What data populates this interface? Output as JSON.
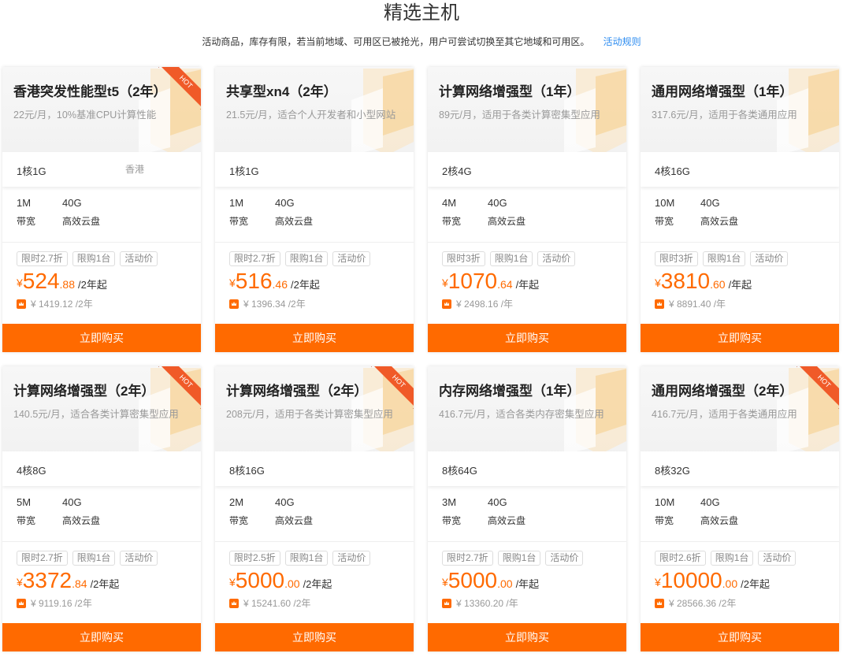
{
  "header": {
    "title": "精选主机",
    "notice": "活动商品，库存有限，若当前地域、可用区已被抢光，用户可尝试切换至其它地域和可用区。",
    "rules_link": "活动规则"
  },
  "cards": [
    {
      "title": "香港突发性能型t5（2年）",
      "desc": "22元/月，10%基准CPU计算性能",
      "hot": true,
      "hot_label": "HOT",
      "spec": "1核1G",
      "region": "香港",
      "bandwidth": "1M",
      "bandwidth_label": "带宽",
      "disk": "40G",
      "disk_label": "高效云盘",
      "tags": [
        "限时2.7折",
        "限购1台",
        "活动价"
      ],
      "currency": "¥",
      "price_int": "524",
      "price_dec": ".88",
      "price_unit": "/2年起",
      "orig_price": "¥ 1419.12 /2年",
      "buy_label": "立即购买"
    },
    {
      "title": "共享型xn4（2年）",
      "desc": "21.5元/月，适合个人开发者和小型网站",
      "hot": false,
      "hot_label": "",
      "spec": "1核1G",
      "region": "",
      "bandwidth": "1M",
      "bandwidth_label": "带宽",
      "disk": "40G",
      "disk_label": "高效云盘",
      "tags": [
        "限时2.7折",
        "限购1台",
        "活动价"
      ],
      "currency": "¥",
      "price_int": "516",
      "price_dec": ".46",
      "price_unit": "/2年起",
      "orig_price": "¥ 1396.34 /2年",
      "buy_label": "立即购买"
    },
    {
      "title": "计算网络增强型（1年）",
      "desc": "89元/月，适用于各类计算密集型应用",
      "hot": false,
      "hot_label": "",
      "spec": "2核4G",
      "region": "",
      "bandwidth": "4M",
      "bandwidth_label": "带宽",
      "disk": "40G",
      "disk_label": "高效云盘",
      "tags": [
        "限时3折",
        "限购1台",
        "活动价"
      ],
      "currency": "¥",
      "price_int": "1070",
      "price_dec": ".64",
      "price_unit": "/年起",
      "orig_price": "¥ 2498.16 /年",
      "buy_label": "立即购买"
    },
    {
      "title": "通用网络增强型（1年）",
      "desc": "317.6元/月，适用于各类通用应用",
      "hot": false,
      "hot_label": "",
      "spec": "4核16G",
      "region": "",
      "bandwidth": "10M",
      "bandwidth_label": "带宽",
      "disk": "40G",
      "disk_label": "高效云盘",
      "tags": [
        "限时3折",
        "限购1台",
        "活动价"
      ],
      "currency": "¥",
      "price_int": "3810",
      "price_dec": ".60",
      "price_unit": "/年起",
      "orig_price": "¥ 8891.40 /年",
      "buy_label": "立即购买"
    },
    {
      "title": "计算网络增强型（2年）",
      "desc": "140.5元/月，适合各类计算密集型应用",
      "hot": true,
      "hot_label": "HOT",
      "spec": "4核8G",
      "region": "",
      "bandwidth": "5M",
      "bandwidth_label": "带宽",
      "disk": "40G",
      "disk_label": "高效云盘",
      "tags": [
        "限时2.7折",
        "限购1台",
        "活动价"
      ],
      "currency": "¥",
      "price_int": "3372",
      "price_dec": ".84",
      "price_unit": "/2年起",
      "orig_price": "¥ 9119.16 /2年",
      "buy_label": "立即购买"
    },
    {
      "title": "计算网络增强型（2年）",
      "desc": "208元/月，适用于各类计算密集型应用",
      "hot": true,
      "hot_label": "HOT",
      "spec": "8核16G",
      "region": "",
      "bandwidth": "2M",
      "bandwidth_label": "带宽",
      "disk": "40G",
      "disk_label": "高效云盘",
      "tags": [
        "限时2.5折",
        "限购1台",
        "活动价"
      ],
      "currency": "¥",
      "price_int": "5000",
      "price_dec": ".00",
      "price_unit": "/2年起",
      "orig_price": "¥ 15241.60 /2年",
      "buy_label": "立即购买"
    },
    {
      "title": "内存网络增强型（1年）",
      "desc": "416.7元/月，适合各类内存密集型应用",
      "hot": false,
      "hot_label": "",
      "spec": "8核64G",
      "region": "",
      "bandwidth": "3M",
      "bandwidth_label": "带宽",
      "disk": "40G",
      "disk_label": "高效云盘",
      "tags": [
        "限时2.7折",
        "限购1台",
        "活动价"
      ],
      "currency": "¥",
      "price_int": "5000",
      "price_dec": ".00",
      "price_unit": "/年起",
      "orig_price": "¥ 13360.20 /年",
      "buy_label": "立即购买"
    },
    {
      "title": "通用网络增强型（2年）",
      "desc": "416.7元/月，适用于各类通用应用",
      "hot": true,
      "hot_label": "HOT",
      "spec": "8核32G",
      "region": "",
      "bandwidth": "10M",
      "bandwidth_label": "带宽",
      "disk": "40G",
      "disk_label": "高效云盘",
      "tags": [
        "限时2.6折",
        "限购1台",
        "活动价"
      ],
      "currency": "¥",
      "price_int": "10000",
      "price_dec": ".00",
      "price_unit": "/2年起",
      "orig_price": "¥ 28566.36 /2年",
      "buy_label": "立即购买"
    }
  ],
  "colors": {
    "accent": "#ff6a00",
    "link": "#2d8cf0",
    "ribbon": "#f05a28",
    "deco": "#f6c878"
  }
}
